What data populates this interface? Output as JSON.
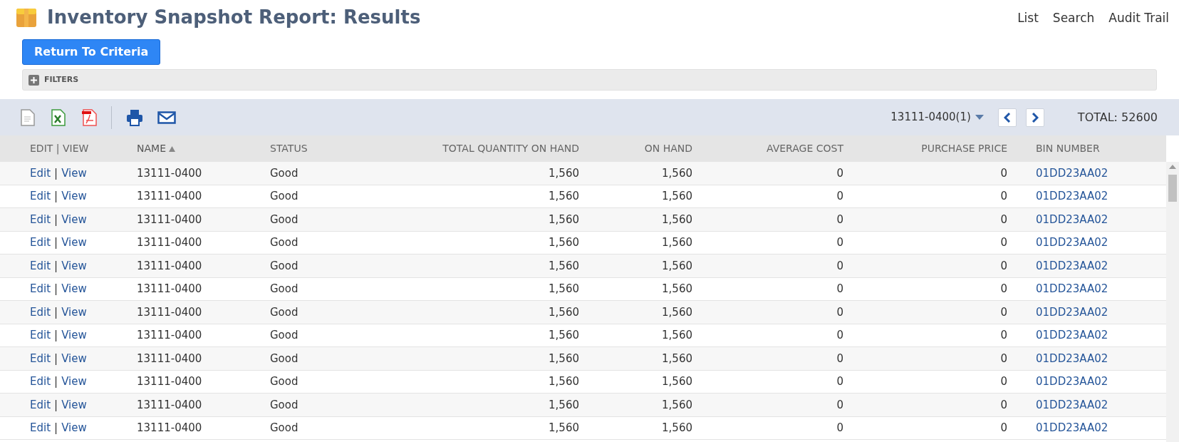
{
  "page": {
    "title": "Inventory Snapshot Report: Results",
    "nav": [
      "List",
      "Search",
      "Audit Trail"
    ],
    "button": "Return To Criteria",
    "filters": {
      "label": "FILTERS",
      "expanded": false
    }
  },
  "toolbar": {
    "selector": "13111-0400(1)",
    "total": "TOTAL: 52600"
  },
  "table": {
    "columns": [
      {
        "label": "EDIT | VIEW",
        "sorted": false
      },
      {
        "label": "NAME",
        "sorted": true
      },
      {
        "label": "STATUS",
        "sorted": false
      },
      {
        "label": "TOTAL QUANTITY ON HAND",
        "sorted": false
      },
      {
        "label": "ON HAND",
        "sorted": false
      },
      {
        "label": "AVERAGE COST",
        "sorted": false
      },
      {
        "label": "PURCHASE PRICE",
        "sorted": false
      },
      {
        "label": "BIN NUMBER",
        "sorted": false
      }
    ],
    "rows_separator": "|",
    "rows": [
      {
        "edit": "Edit",
        "view": "View",
        "name": "13111-0400",
        "status": "Good",
        "total_qty": "1,560",
        "on_hand": "1,560",
        "avg_cost": "0",
        "purchase_price": "0",
        "bin": "01DD23AA02"
      },
      {
        "edit": "Edit",
        "view": "View",
        "name": "13111-0400",
        "status": "Good",
        "total_qty": "1,560",
        "on_hand": "1,560",
        "avg_cost": "0",
        "purchase_price": "0",
        "bin": "01DD23AA02"
      },
      {
        "edit": "Edit",
        "view": "View",
        "name": "13111-0400",
        "status": "Good",
        "total_qty": "1,560",
        "on_hand": "1,560",
        "avg_cost": "0",
        "purchase_price": "0",
        "bin": "01DD23AA02"
      },
      {
        "edit": "Edit",
        "view": "View",
        "name": "13111-0400",
        "status": "Good",
        "total_qty": "1,560",
        "on_hand": "1,560",
        "avg_cost": "0",
        "purchase_price": "0",
        "bin": "01DD23AA02"
      },
      {
        "edit": "Edit",
        "view": "View",
        "name": "13111-0400",
        "status": "Good",
        "total_qty": "1,560",
        "on_hand": "1,560",
        "avg_cost": "0",
        "purchase_price": "0",
        "bin": "01DD23AA02"
      },
      {
        "edit": "Edit",
        "view": "View",
        "name": "13111-0400",
        "status": "Good",
        "total_qty": "1,560",
        "on_hand": "1,560",
        "avg_cost": "0",
        "purchase_price": "0",
        "bin": "01DD23AA02"
      },
      {
        "edit": "Edit",
        "view": "View",
        "name": "13111-0400",
        "status": "Good",
        "total_qty": "1,560",
        "on_hand": "1,560",
        "avg_cost": "0",
        "purchase_price": "0",
        "bin": "01DD23AA02"
      },
      {
        "edit": "Edit",
        "view": "View",
        "name": "13111-0400",
        "status": "Good",
        "total_qty": "1,560",
        "on_hand": "1,560",
        "avg_cost": "0",
        "purchase_price": "0",
        "bin": "01DD23AA02"
      },
      {
        "edit": "Edit",
        "view": "View",
        "name": "13111-0400",
        "status": "Good",
        "total_qty": "1,560",
        "on_hand": "1,560",
        "avg_cost": "0",
        "purchase_price": "0",
        "bin": "01DD23AA02"
      },
      {
        "edit": "Edit",
        "view": "View",
        "name": "13111-0400",
        "status": "Good",
        "total_qty": "1,560",
        "on_hand": "1,560",
        "avg_cost": "0",
        "purchase_price": "0",
        "bin": "01DD23AA02"
      },
      {
        "edit": "Edit",
        "view": "View",
        "name": "13111-0400",
        "status": "Good",
        "total_qty": "1,560",
        "on_hand": "1,560",
        "avg_cost": "0",
        "purchase_price": "0",
        "bin": "01DD23AA02"
      },
      {
        "edit": "Edit",
        "view": "View",
        "name": "13111-0400",
        "status": "Good",
        "total_qty": "1,560",
        "on_hand": "1,560",
        "avg_cost": "0",
        "purchase_price": "0",
        "bin": "01DD23AA02"
      }
    ]
  }
}
